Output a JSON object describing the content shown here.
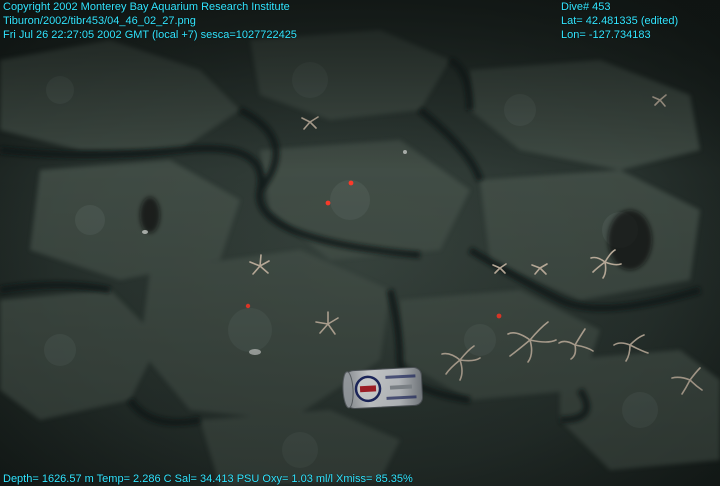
{
  "overlay": {
    "top_left": [
      "Copyright 2002 Monterey Bay Aquarium Research Institute",
      "Tiburon/2002/tibr453/04_46_02_27.png",
      "Fri Jul 26 22:27:05 2002 GMT (local +7)  sesca=1027722425"
    ],
    "top_right": [
      "Dive# 453",
      "Lat= 42.481335 (edited)",
      "Lon= -127.734183"
    ],
    "bottom": "Depth= 1626.57 m  Temp= 2.286 C  Sal= 34.413 PSU  Oxy= 1.03 ml/l  Xmiss= 85.35%"
  },
  "scene": {
    "description_colors": {
      "seafloor": "#2b3531",
      "rock_light": "#4a5650",
      "rock_dark": "#141a18",
      "laser": "#ff3b2a",
      "can_body": "#e6e8ec",
      "can_label": "#c8202a"
    }
  }
}
